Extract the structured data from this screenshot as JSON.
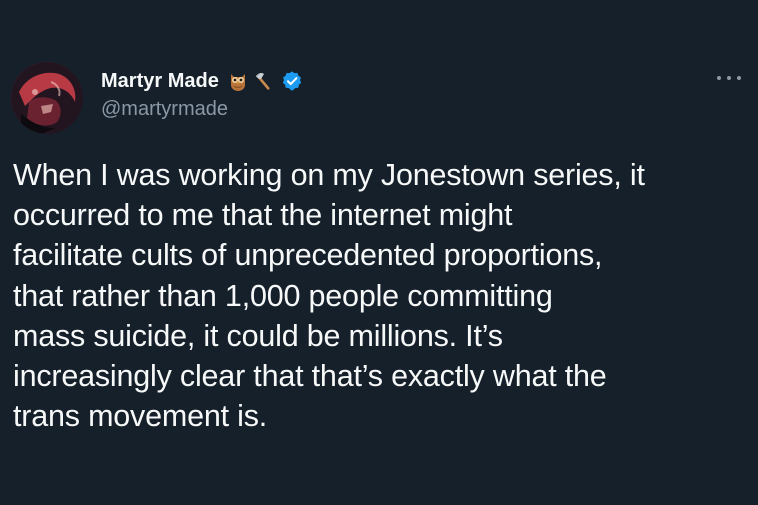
{
  "tweet": {
    "author": {
      "display_name": "Martyr Made",
      "handle": "@martyrmade",
      "name_emojis": [
        "owl-emoji",
        "axe-emoji"
      ],
      "verified": true
    },
    "text": "When I was working on my Jonestown series, it\noccurred to me that the internet might\nfacilitate cults of unprecedented proportions,\nthat rather than 1,000 people committing\nmass suicide, it could be millions. It’s\nincreasingly clear that that’s exactly what the\ntrans movement is.",
    "more_icon": "more-options-icon"
  },
  "colors": {
    "background": "#15202b",
    "primary_text": "#f7f9f9",
    "secondary_text": "#8b98a5",
    "verified_blue": "#1d9bf0"
  }
}
